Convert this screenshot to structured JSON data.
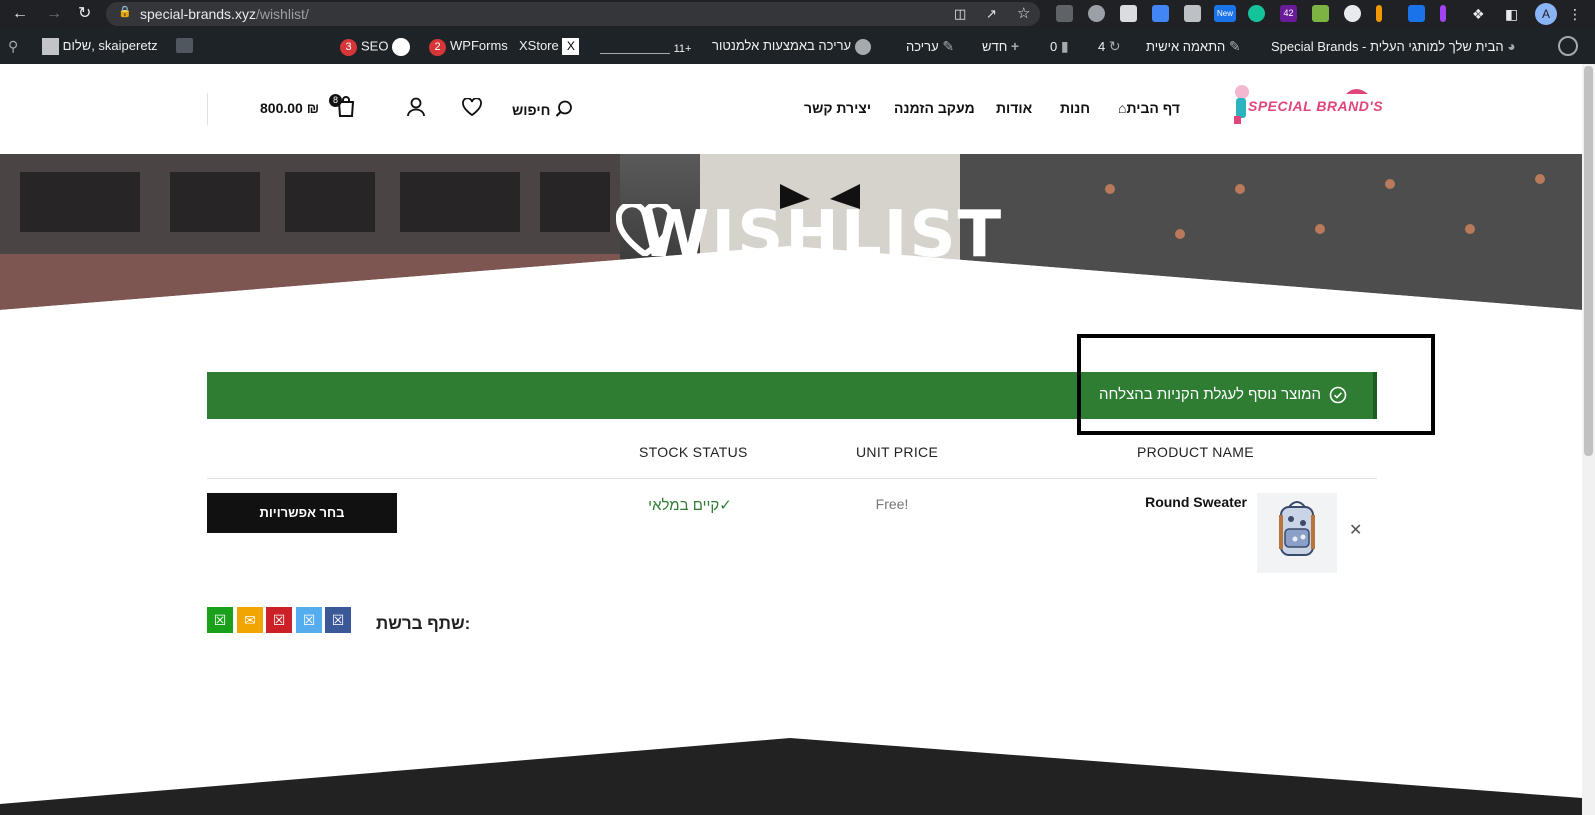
{
  "browser": {
    "url_host": "special-brands.xyz",
    "url_path": "/wishlist/",
    "ext_new_label": "New",
    "ext_count": "42",
    "profile_initial": "A"
  },
  "adminbar": {
    "site_name": "Special Brands - הבית שלך למותגי העלית",
    "customize": "התאמה אישית",
    "updates_count": "4",
    "comments_count": "0",
    "new_label": "חדש",
    "edit_label": "עריכה",
    "elementor_label": "עריכה באמצעות אלמנטור",
    "perf_label": "11+",
    "xstore_label": "XStore",
    "wpforms_label": "WPForms",
    "wpforms_badge": "2",
    "seo_label": "SEO",
    "seo_badge": "3",
    "user_greeting": "שלום, skaiperetz"
  },
  "header": {
    "logo_text": "SPECIAL BRAND'S",
    "menu": [
      "דף הבית",
      "חנות",
      "אודות",
      "מעקב הזמנה",
      "יצירת קשר"
    ],
    "search_label": "חיפוש",
    "cart_total": "800.00 ₪",
    "cart_count": "8"
  },
  "hero": {
    "title": "WISHLIST"
  },
  "notice": {
    "text": "המוצר נוסף לעגלת הקניות בהצלחה"
  },
  "table": {
    "headers": {
      "product_name": "PRODUCT NAME",
      "unit_price": "UNIT PRICE",
      "stock_status": "STOCK STATUS"
    },
    "rows": [
      {
        "name": "Round Sweater",
        "price": "Free!",
        "stock": "קיים במלאי",
        "action": "בחר אפשרויות"
      }
    ]
  },
  "share": {
    "label": "שתף ברשת:",
    "buttons": [
      {
        "name": "facebook",
        "color": "#3b5998"
      },
      {
        "name": "twitter",
        "color": "#55acee"
      },
      {
        "name": "pinterest",
        "color": "#cb2027"
      },
      {
        "name": "email",
        "color": "#f0a500"
      },
      {
        "name": "whatsapp",
        "color": "#1aa01a"
      }
    ]
  },
  "colors": {
    "notice_bg": "#2e7d32",
    "stock_green": "#2e7d32",
    "button_black": "#111111",
    "admin_bar": "#1d2327"
  }
}
